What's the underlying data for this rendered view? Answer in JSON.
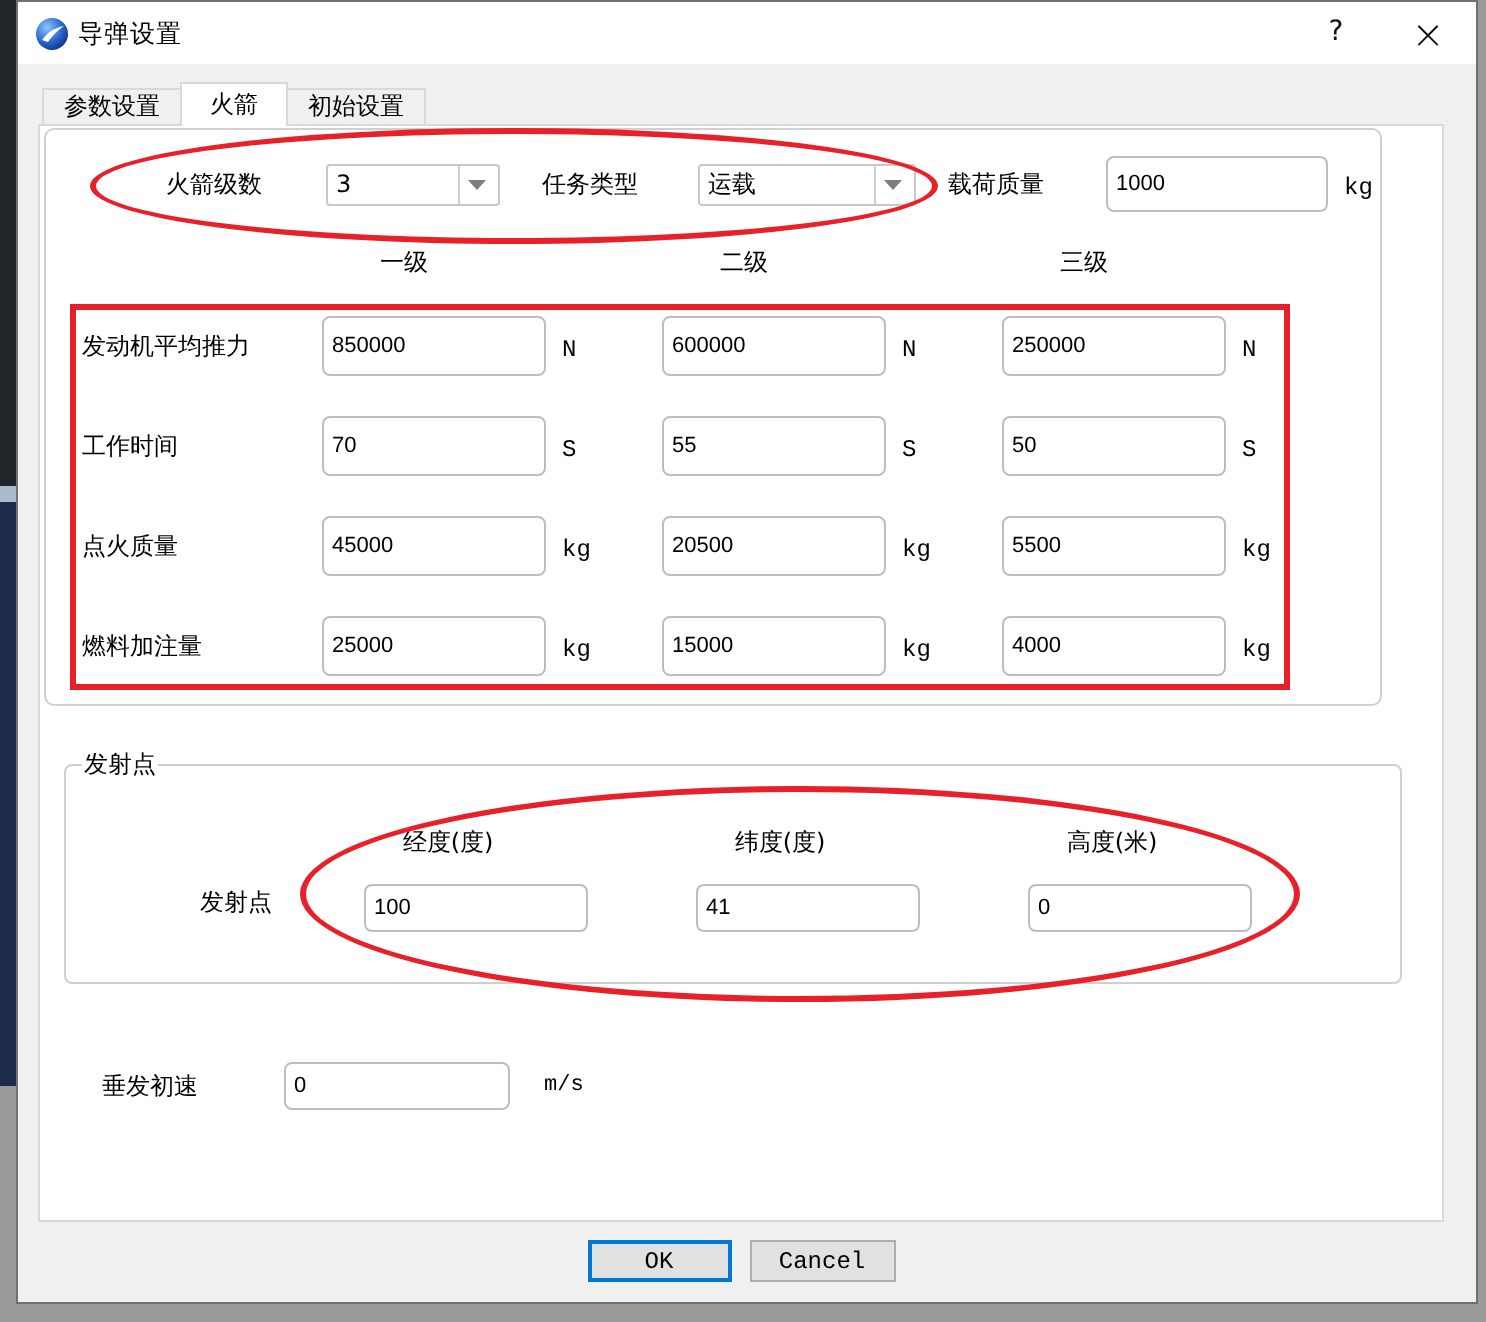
{
  "window": {
    "title": "导弹设置",
    "controls": [
      {
        "kind": "help",
        "label": "?"
      },
      {
        "kind": "close",
        "label": "×"
      }
    ]
  },
  "tabs": [
    {
      "label": "参数设置",
      "selected": false
    },
    {
      "label": "火箭",
      "selected": true
    },
    {
      "label": "初始设置",
      "selected": false
    }
  ],
  "rocket_setup": {
    "circled": true,
    "fields": [
      {
        "label": "火箭级数",
        "value": "3"
      },
      {
        "label": "任务类型",
        "value": "运载"
      }
    ]
  },
  "payload_mass": {
    "label": "载荷质量",
    "value": "1000",
    "unit": "kg"
  },
  "stages": {
    "boxed": true,
    "columns": [
      "一级",
      "二级",
      "三级"
    ],
    "rows": [
      {
        "label": "发动机平均推力",
        "cells": [
          {
            "value": "850000",
            "unit": "N"
          },
          {
            "value": "600000",
            "unit": "N"
          },
          {
            "value": "250000",
            "unit": "N"
          }
        ]
      },
      {
        "label": "工作时间",
        "cells": [
          {
            "value": "70",
            "unit": "S"
          },
          {
            "value": "55",
            "unit": "S"
          },
          {
            "value": "50",
            "unit": "S"
          }
        ]
      },
      {
        "label": "点火质量",
        "cells": [
          {
            "value": "45000",
            "unit": "kg"
          },
          {
            "value": "20500",
            "unit": "kg"
          },
          {
            "value": "5500",
            "unit": "kg"
          }
        ]
      },
      {
        "label": "燃料加注量",
        "cells": [
          {
            "value": "25000",
            "unit": "kg"
          },
          {
            "value": "15000",
            "unit": "kg"
          },
          {
            "value": "4000",
            "unit": "kg"
          }
        ]
      }
    ]
  },
  "launch_point": {
    "title": "发射点",
    "circled": true,
    "columns": [
      "经度(度)",
      "纬度(度)",
      "高度(米)"
    ],
    "label": "发射点",
    "values": [
      "100",
      "41",
      "0"
    ]
  },
  "initial_velocity": {
    "label": "垂发初速",
    "value": "0",
    "unit": "m/s"
  },
  "buttons": [
    {
      "label": "OK",
      "default": true
    },
    {
      "label": "Cancel",
      "default": false
    }
  ]
}
